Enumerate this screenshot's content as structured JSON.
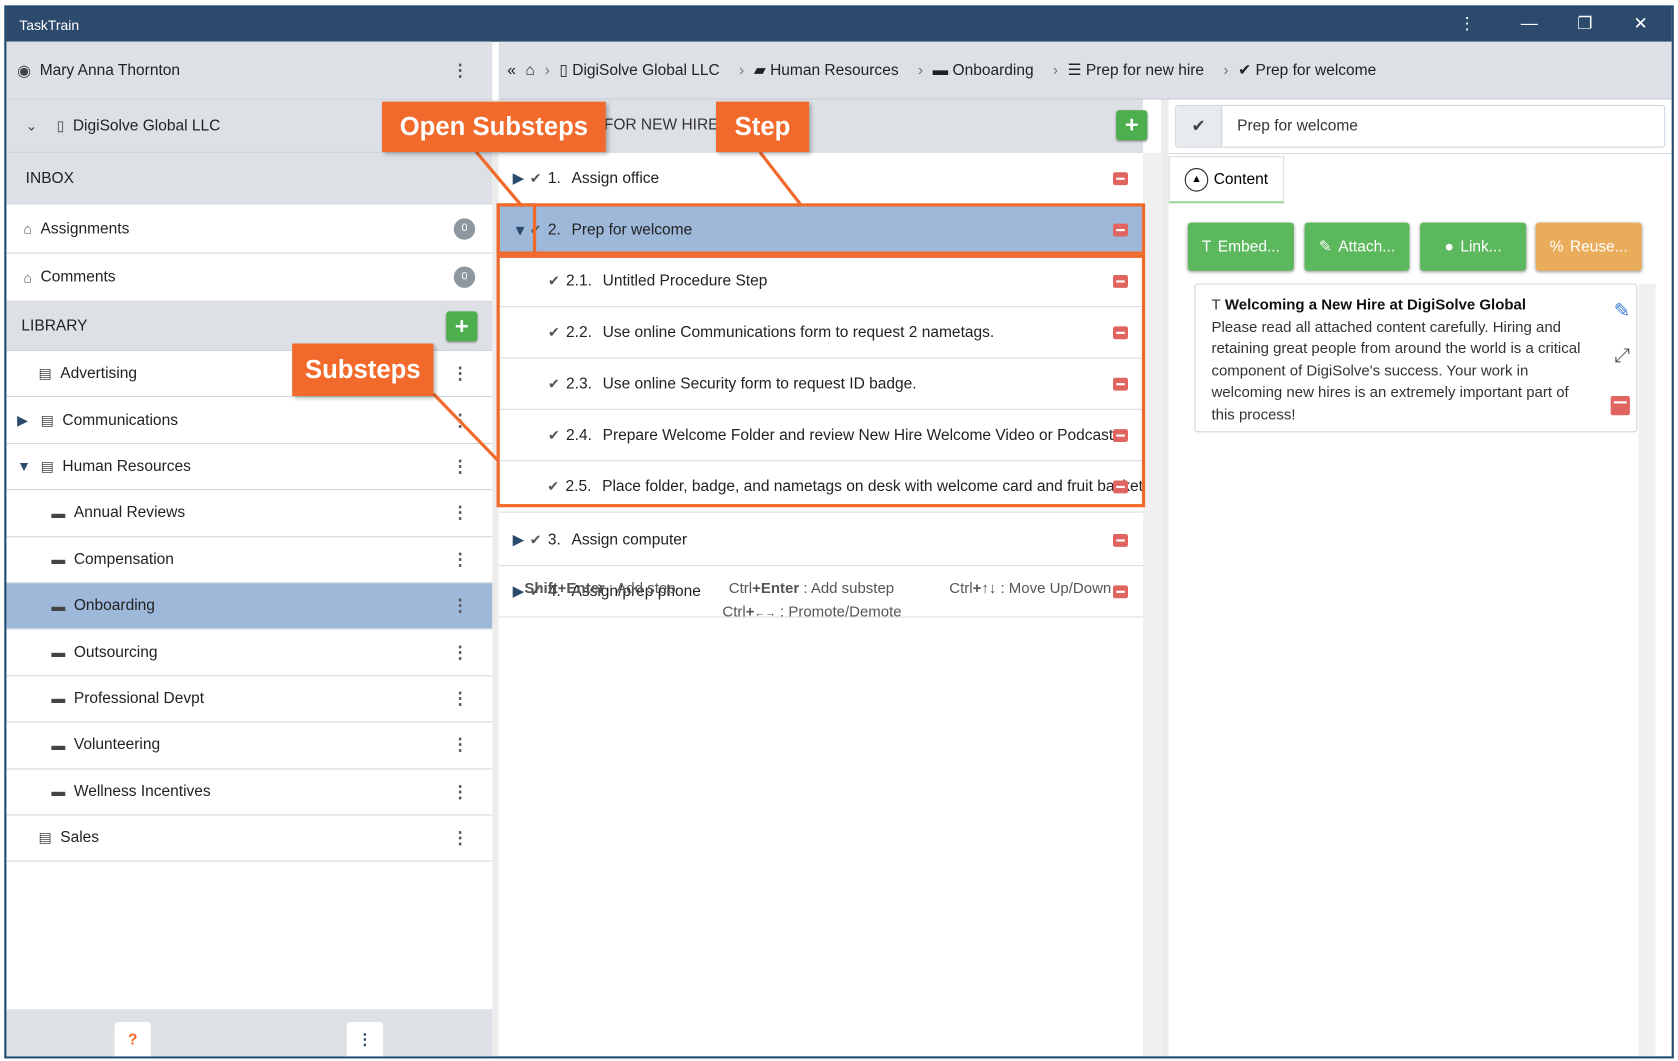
{
  "window": {
    "title": "TaskTrain",
    "controls": [
      "⋮",
      "—",
      "❐",
      "✕"
    ]
  },
  "user": {
    "name": "Mary Anna Thornton"
  },
  "org": {
    "name": "DigiSolve Global LLC"
  },
  "inbox": {
    "header": "INBOX",
    "items": [
      {
        "label": "Assignments",
        "count": "0"
      },
      {
        "label": "Comments",
        "count": "0"
      }
    ]
  },
  "library": {
    "header": "LIBRARY",
    "items": [
      {
        "label": "Advertising",
        "level": 0,
        "expander": ""
      },
      {
        "label": "Communications",
        "level": 0,
        "expander": "collapsed"
      },
      {
        "label": "Human Resources",
        "level": 0,
        "expander": "expanded"
      },
      {
        "label": "Annual Reviews",
        "level": 1
      },
      {
        "label": "Compensation",
        "level": 1
      },
      {
        "label": "Onboarding",
        "level": 1,
        "selected": true
      },
      {
        "label": "Outsourcing",
        "level": 1
      },
      {
        "label": "Professional Devpt",
        "level": 1
      },
      {
        "label": "Volunteering",
        "level": 1
      },
      {
        "label": "Wellness Incentives",
        "level": 1
      },
      {
        "label": "Sales",
        "level": 0
      }
    ]
  },
  "breadcrumb": [
    "DigiSolve Global LLC",
    "Human Resources",
    "Onboarding",
    "Prep for new hire",
    "Prep for welcome"
  ],
  "procedure": {
    "title": "PREP FOR NEW HIRE",
    "steps": [
      {
        "num": "1.",
        "label": "Assign office"
      },
      {
        "num": "2.",
        "label": "Prep for welcome",
        "selected": true
      },
      {
        "num": "2.1.",
        "label": "Untitled Procedure Step"
      },
      {
        "num": "2.2.",
        "label": "Use online Communications form to request 2 nametags."
      },
      {
        "num": "2.3.",
        "label": "Use online Security form to request ID badge."
      },
      {
        "num": "2.4.",
        "label": "Prepare Welcome Folder and review New Hire Welcome Video or Podcast"
      },
      {
        "num": "2.5.",
        "label": "Place folder, badge, and nametags on desk with welcome card and fruit basket"
      },
      {
        "num": "3.",
        "label": "Assign computer"
      },
      {
        "num": "4.",
        "label": "Assign/prep phone"
      }
    ]
  },
  "hints": {
    "add_step_key": "Shift+Enter",
    "add_step": " : Add step",
    "add_sub_key1": "Ctrl",
    "add_sub_key2": "+Enter",
    "add_sub": " : Add substep",
    "move_key1": "Ctrl",
    "move_key2": "+",
    "move_arrows": "↑↓",
    "move": " : Move Up/Down",
    "promote_key1": "Ctrl",
    "promote_key2": "+",
    "promote_arrows": "←→",
    "promote": " : Promote/Demote"
  },
  "detail": {
    "step_title": "Prep for welcome",
    "tab": "Content",
    "buttons": {
      "embed": "Embed...",
      "attach": "Attach...",
      "link": "Link...",
      "reuse": "Reuse..."
    },
    "content": {
      "title": "Welcoming a New Hire at DigiSolve Global",
      "body": "Please read all attached content carefully. Hiring and retaining great people from around the world is a critical component of DigiSolve's success. Your work in welcoming new hires is an extremely important part of this process!"
    }
  },
  "callouts": {
    "open_substeps": "Open Substeps",
    "step": "Step",
    "substeps": "Substeps"
  },
  "colors": {
    "titlebar": "#2c4a6b",
    "selected": "#9db8d9",
    "green": "#5cb85c",
    "orange": "#e8ac5a",
    "callout": "#f26a2b",
    "delete": "#e0645f"
  }
}
